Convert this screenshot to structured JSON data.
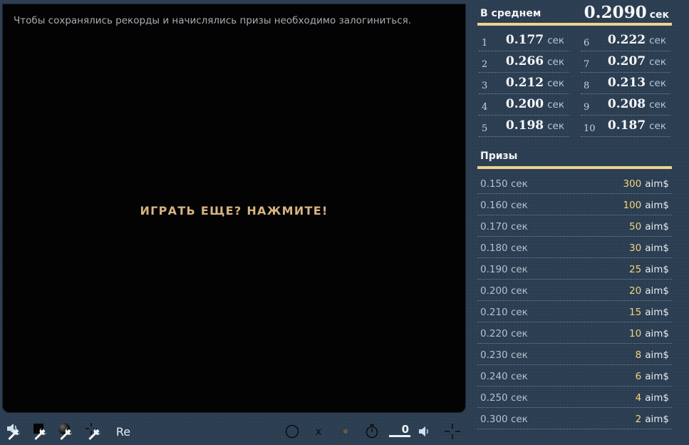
{
  "game": {
    "login_notice": "Чтобы сохранялись рекорды и начислялись призы необходимо залогиниться.",
    "play_again": "ИГРАТЬ ЕЩЕ? НАЖМИТЕ!"
  },
  "toolbar": {
    "re_label": "Re",
    "x_label": "x",
    "counter": "0"
  },
  "stats": {
    "average_label": "В среднем",
    "average_value": "0.2090",
    "unit": "сек",
    "records": [
      {
        "index": "1",
        "time": "0.177"
      },
      {
        "index": "2",
        "time": "0.266"
      },
      {
        "index": "3",
        "time": "0.212"
      },
      {
        "index": "4",
        "time": "0.200"
      },
      {
        "index": "5",
        "time": "0.198"
      },
      {
        "index": "6",
        "time": "0.222"
      },
      {
        "index": "7",
        "time": "0.207"
      },
      {
        "index": "8",
        "time": "0.213"
      },
      {
        "index": "9",
        "time": "0.208"
      },
      {
        "index": "10",
        "time": "0.187"
      }
    ]
  },
  "prizes": {
    "title": "Призы",
    "currency": "aim$",
    "items": [
      {
        "time": "0.150 сек",
        "amount": "300"
      },
      {
        "time": "0.160 сек",
        "amount": "100"
      },
      {
        "time": "0.170 сек",
        "amount": "50"
      },
      {
        "time": "0.180 сек",
        "amount": "30"
      },
      {
        "time": "0.190 сек",
        "amount": "25"
      },
      {
        "time": "0.200 сек",
        "amount": "20"
      },
      {
        "time": "0.210 сек",
        "amount": "15"
      },
      {
        "time": "0.220 сек",
        "amount": "10"
      },
      {
        "time": "0.230 сек",
        "amount": "8"
      },
      {
        "time": "0.240 сек",
        "amount": "6"
      },
      {
        "time": "0.250 сек",
        "amount": "4"
      },
      {
        "time": "0.300 сек",
        "amount": "2"
      }
    ]
  },
  "colors": {
    "background": "#2b3d51",
    "accent": "#ecd390",
    "prize_amount": "#f1d57e",
    "play_again_text": "#d6b481"
  },
  "icons": [
    "speaker-icon",
    "wrench-icon",
    "square-icon",
    "sphere-icon",
    "crosshair-icon",
    "circle-icon",
    "dot-icon",
    "stopwatch-icon"
  ]
}
